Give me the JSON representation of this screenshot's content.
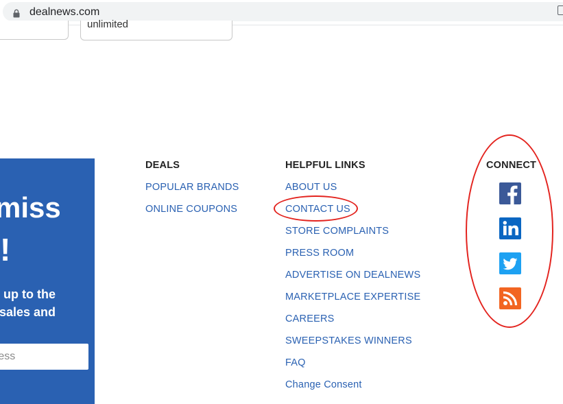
{
  "browser": {
    "url": "dealnews.com"
  },
  "cards": {
    "right_text": "unlimited"
  },
  "promo": {
    "headline_1": "miss",
    "headline_2": "!",
    "sub_line_1": "r up to the",
    "sub_line_2": "sales and",
    "email_placeholder": "ress"
  },
  "deals": {
    "heading": "DEALS",
    "links": [
      "POPULAR BRANDS",
      "ONLINE COUPONS"
    ]
  },
  "helpful": {
    "heading": "HELPFUL LINKS",
    "links": [
      "ABOUT US",
      "CONTACT US",
      "STORE COMPLAINTS",
      "PRESS ROOM",
      "ADVERTISE ON DEALNEWS",
      "MARKETPLACE EXPERTISE",
      "CAREERS",
      "SWEEPSTAKES WINNERS",
      "FAQ",
      "Change Consent"
    ]
  },
  "connect": {
    "heading": "CONNECT",
    "icons": [
      "facebook-icon",
      "linkedin-icon",
      "twitter-icon",
      "rss-icon"
    ]
  },
  "colors": {
    "brand_blue": "#2a61b2",
    "link_blue": "#2a61b2",
    "annotation_red": "#e3231e",
    "facebook": "#3b5998",
    "linkedin": "#0a66c2",
    "twitter": "#1da1f2",
    "rss": "#f26522"
  }
}
